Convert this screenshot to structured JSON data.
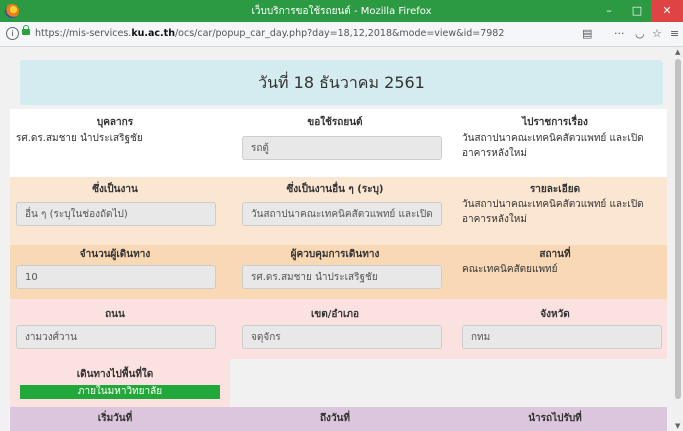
{
  "window": {
    "title": "เว็บบริการขอใช้รถยนต์ - Mozilla Firefox",
    "controls": {
      "minimize": "–",
      "maximize": "□",
      "close": "✕"
    }
  },
  "urlbar": {
    "url_prefix": "https://mis-services.",
    "url_domain": "ku.ac.th",
    "url_path": "/ocs/car/popup_car_day.php?day=18,12,2018&mode=view&id=7982",
    "icons": [
      "info-icon",
      "lock-icon",
      "reader-icon",
      "more-icon",
      "pocket-icon",
      "bookmark-star-icon",
      "menu-icon"
    ]
  },
  "page": {
    "header": "วันที่ 18 ธันวาคม 2561",
    "row1": {
      "col1_label": "บุคลากร",
      "col1_value": "รศ.ดร.สมชาย นำประเสริฐชัย",
      "col2_label": "ขอใช้รถยนต์",
      "col2_value": "รถตู้",
      "col3_label": "ไปราชการเรื่อง",
      "col3_value": "วันสถาปนาคณะเทคนิคสัตวแพทย์ และเปิด อาคารหลังใหม่"
    },
    "row2": {
      "col1_label": "ซึ่งเป็นงาน",
      "col1_value": "อื่น ๆ (ระบุในช่องถัดไป)",
      "col2_label": "ซึ่งเป็นงานอื่น ๆ (ระบุ)",
      "col2_value": "วันสถาปนาคณะเทคนิคสัตวแพทย์ และเปิด",
      "col3_label": "รายละเอียด",
      "col3_value": "วันสถาปนาคณะเทคนิคสัตวแพทย์ และเปิด อาคารหลังใหม่"
    },
    "row3": {
      "col1_label": "จำนวนผู้เดินทาง",
      "col1_value": "10",
      "col2_label": "ผู้ควบคุมการเดินทาง",
      "col2_value": "รศ.ดร.สมชาย นำประเสริฐชัย",
      "col3_label": "สถานที่",
      "col3_value": "คณะเทคนิคสัตยแพทย์"
    },
    "row4": {
      "col1_label": "ถนน",
      "col1_value": "งามวงศ์วาน",
      "col2_label": "เขต/อำเภอ",
      "col2_value": "จตุจักร",
      "col3_label": "จังหวัด",
      "col3_value": "กทม"
    },
    "row5": {
      "col1_label": "เดินทางไปพื้นที่ใด",
      "col1_value": "ภายในมหาวิทยาลัย"
    },
    "row6": {
      "col1_label": "เริ่มวันที่",
      "col2_label": "ถึงวันที่",
      "col3_label": "นำรถไปรับที่"
    }
  },
  "colors": {
    "titlebar": "#2c9a43",
    "badge": "#22a83a",
    "header": "#d4ecf0"
  }
}
